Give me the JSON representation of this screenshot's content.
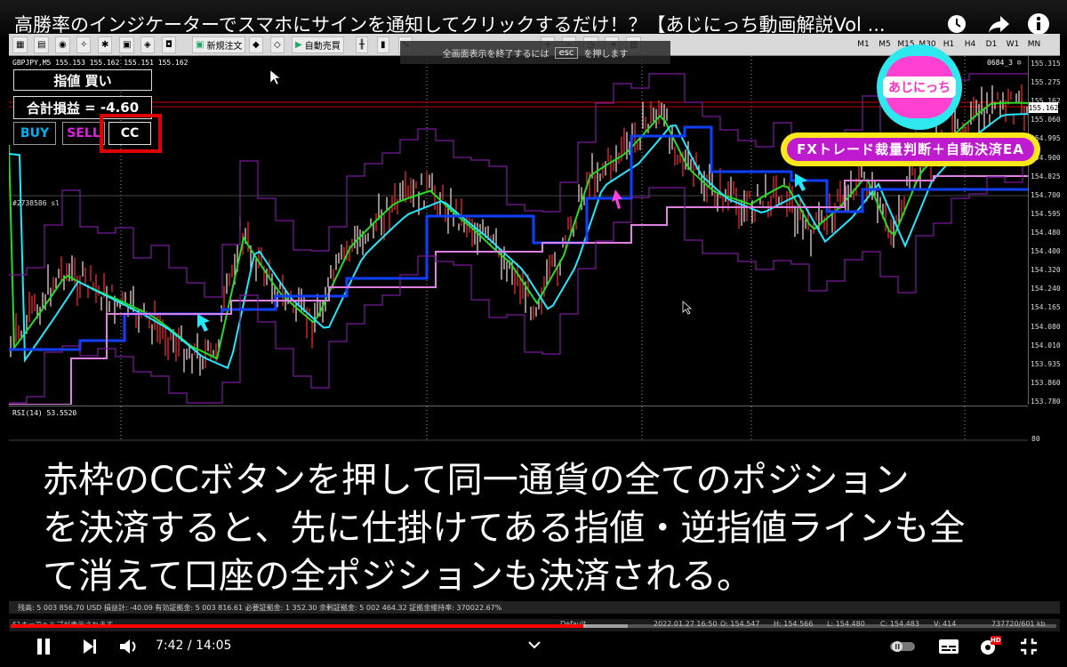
{
  "video": {
    "title": "高勝率のインジケーターでスマホにサインを通知してクリックするだけ！？【あじにっち動画解説Vol ...",
    "time_current": "7:42",
    "time_separator": "/",
    "time_total": "14:05",
    "progress": 0.548,
    "buffered": 0.59,
    "hd_badge": "HD"
  },
  "esc_notice": {
    "before": "全画面表示を終了するには",
    "key": "esc",
    "after": "を押します"
  },
  "toolbar": {
    "new_order": "新規注文",
    "auto_trade": "自動売買",
    "timeframes": [
      "M1",
      "M5",
      "M15",
      "M30",
      "H1",
      "H4",
      "D1",
      "W1",
      "MN"
    ]
  },
  "chart": {
    "symbol_line": "GBPJPY,M5  155.153 155.162 155.151 155.162",
    "account_label": "0684_3 ☺",
    "object_label": "#2738586 sl",
    "current_price": "155.162",
    "price_ticks": [
      "155.315",
      "155.275",
      "155.162",
      "155.060",
      "154.995",
      "154.900",
      "154.825",
      "154.700",
      "154.595",
      "154.480",
      "154.400",
      "154.320",
      "154.240",
      "154.165",
      "154.080",
      "154.010",
      "153.935",
      "153.860",
      "153.780"
    ],
    "rsi_label": "RSI(14) 53.5520",
    "rsi_ticks": [
      "80"
    ]
  },
  "panel": {
    "order_type": "指値 買い",
    "pl_label": "合計損益",
    "pl_eq": "=",
    "pl_value": "-4.60",
    "buy": "BUY",
    "sell": "SELL",
    "cc": "CC"
  },
  "logo": {
    "text": "あじにっち",
    "banner": "FXトレード裁量判断＋自動決済EA"
  },
  "caption": {
    "line1": "赤枠のCCボタンを押して同一通貨の全てのポジション",
    "line2": "を決済すると、先に仕掛けてある指値・逆指値ラインも全",
    "line3": "て消えて口座の全ポジションも決済される。"
  },
  "account_bar": {
    "text": "残高: 5 003 856.70 USD  損益計: -40.09  有効証拠金: 5 003 816.61  必要証拠金: 1 352.30  余剰証拠金: 5 002 464.32  証拠金維持率: 370022.67%"
  },
  "status_bar": {
    "help": "F1キーでヘルプが表示されます",
    "profile": "Default",
    "datetime": "2022.01.27 16:50",
    "open": "O: 154.547",
    "high": "H: 154.566",
    "low": "L: 154.480",
    "close": "C: 154.483",
    "volume": "V: 414",
    "traffic": "737720/601 kb"
  },
  "colors": {
    "accent_red": "#e00000",
    "progress_red": "#ff0000",
    "buy_blue": "#00b0f0",
    "sell_magenta": "#e020e0",
    "logo_cyan": "#2ee8f0",
    "logo_pink": "#ff40d0",
    "banner_yellow": "#ffe81a",
    "banner_purple": "#c01ad0"
  },
  "icons": {
    "clock": "clock-icon",
    "share": "share-icon",
    "info": "info-icon",
    "pause": "pause-icon",
    "next": "next-icon",
    "volume": "volume-icon",
    "autoplay": "autoplay-toggle-icon",
    "subtitles": "subtitles-icon",
    "settings": "settings-icon",
    "fullscreen_exit": "fullscreen-exit-icon",
    "chevron": "chevron-down-icon"
  }
}
